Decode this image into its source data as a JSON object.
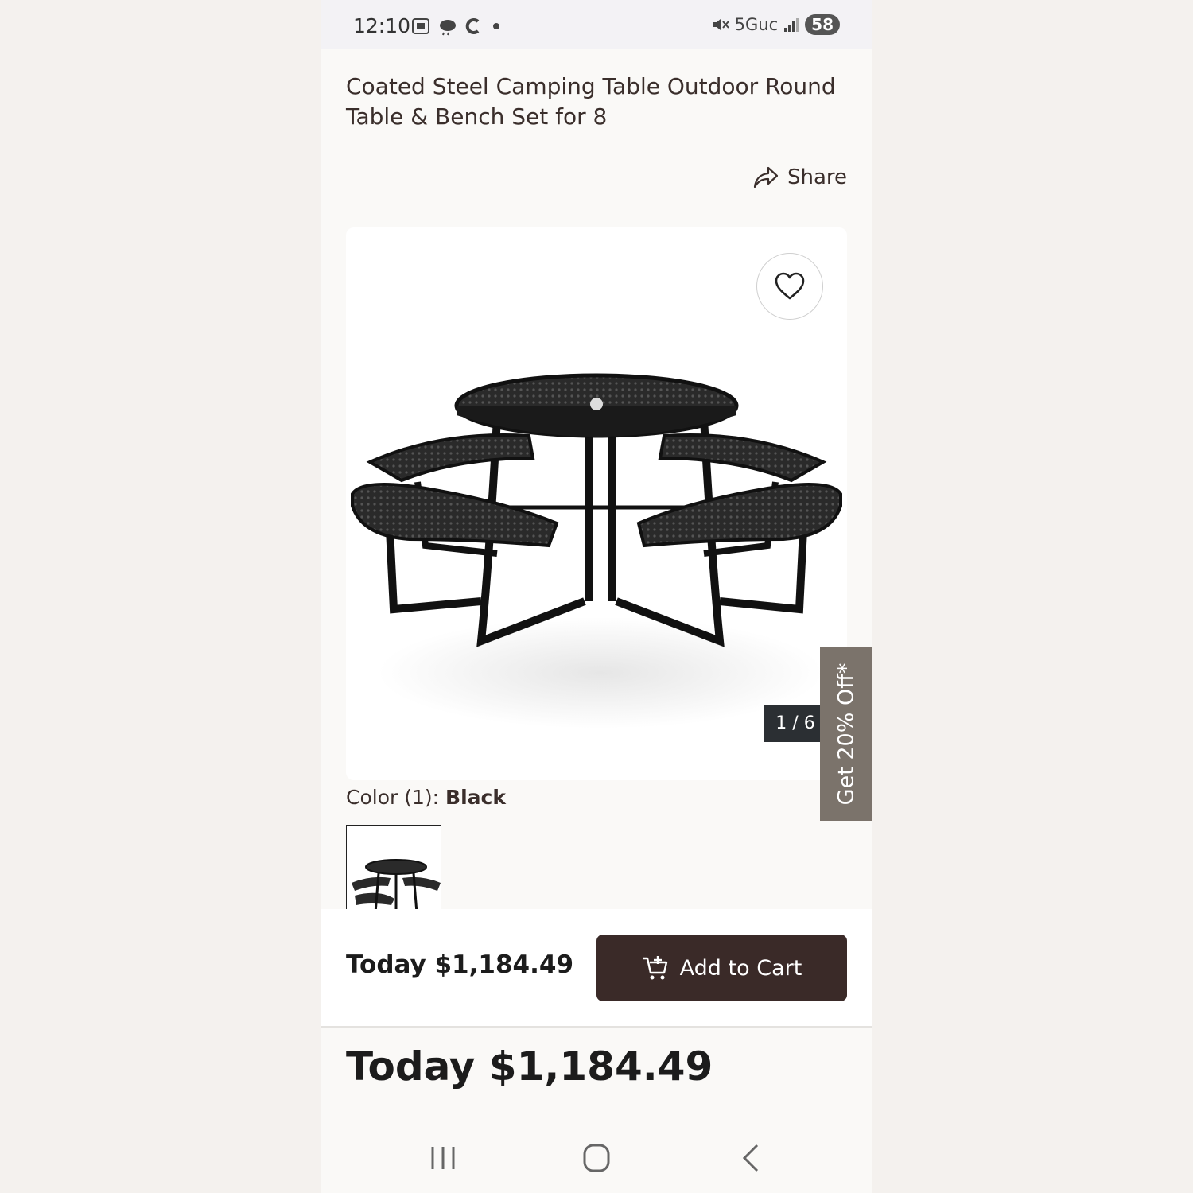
{
  "status_bar": {
    "time": "12:10",
    "network": "5Guc",
    "battery": "58"
  },
  "product": {
    "title": "Coated Steel Camping Table Outdoor Round Table & Bench Set for 8",
    "share_label": "Share",
    "image_counter": "1 / 6",
    "color_label": "Color (1):",
    "color_value": "Black"
  },
  "promo": {
    "label": "Get 20% Off*"
  },
  "cart_bar": {
    "price": "Today $1,184.49",
    "add_to_cart_label": "Add to Cart"
  },
  "price_section": {
    "price": "Today $1,184.49"
  },
  "colors": {
    "cart_button": "#3a2a28",
    "promo_tab": "#7b736b",
    "counter_badge": "#2b2f33"
  }
}
